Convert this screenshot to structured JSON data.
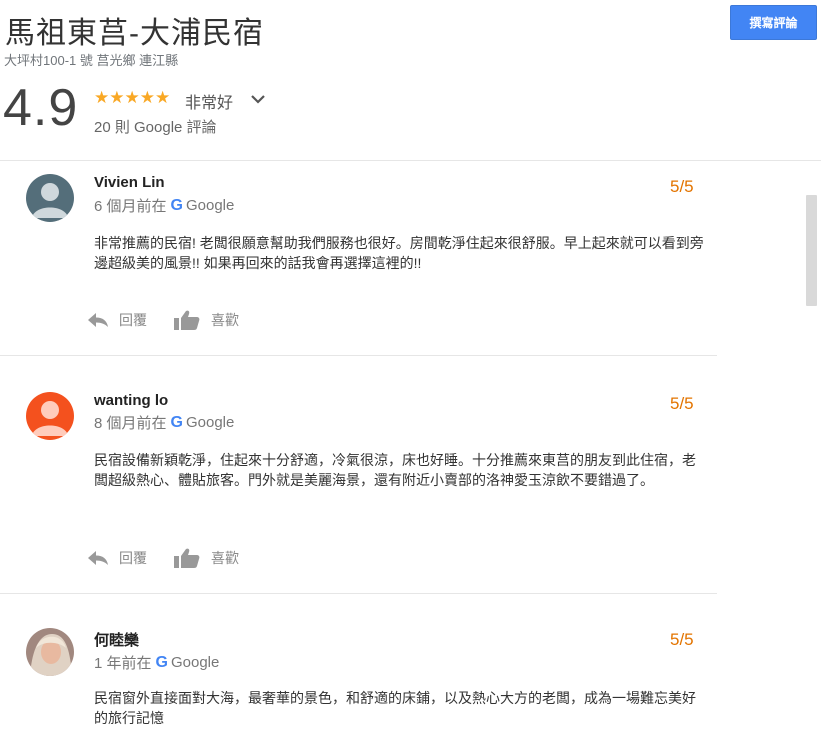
{
  "header": {
    "title": "馬祖東莒-大浦民宿",
    "address": "大坪村100-1 號 莒光鄉 連江縣",
    "write_review_label": "撰寫評論"
  },
  "summary": {
    "rating": "4.9",
    "stars": "★★★★★",
    "rating_word": "非常好",
    "review_count": "20 則 Google 評論"
  },
  "labels": {
    "google": "Google",
    "reply": "回覆",
    "like": "喜歡"
  },
  "reviews": [
    {
      "name": "Vivien Lin",
      "time": "6 個月前在",
      "score": "5/5",
      "text": "非常推薦的民宿! 老闆很願意幫助我們服務也很好。房間乾淨住起來很舒服。早上起來就可以看到旁邊超級美的風景!! 如果再回來的話我會再選擇這裡的!!",
      "avatar_color": "#546e7a"
    },
    {
      "name": "wanting lo",
      "time": "8 個月前在",
      "score": "5/5",
      "text": "民宿設備新穎乾淨，住起來十分舒適，冷氣很涼，床也好睡。十分推薦來東莒的朋友到此住宿，老闆超級熱心、體貼旅客。門外就是美麗海景，還有附近小賣部的洛神愛玉涼飲不要錯過了。",
      "avatar_color": "#f4511e"
    },
    {
      "name": "何睦欒",
      "time": "1 年前在",
      "score": "5/5",
      "text": "民宿窗外直接面對大海，最奢華的景色，和舒適的床鋪，以及熱心大方的老闆，成為一場難忘美好的旅行記憶",
      "avatar_color": "#a1887f"
    }
  ],
  "colors": {
    "accent": "#4285f4",
    "star": "#f9a825",
    "score": "#e37400"
  }
}
